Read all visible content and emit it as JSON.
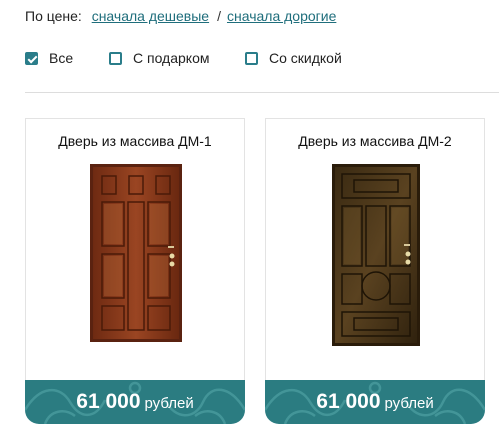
{
  "sort": {
    "label": "По цене:",
    "cheap_first": "сначала дешевые",
    "separator": "/",
    "expensive_first": "сначала дорогие"
  },
  "filters": [
    {
      "label": "Все",
      "checked": true
    },
    {
      "label": "С подарком",
      "checked": false
    },
    {
      "label": "Со скидкой",
      "checked": false
    }
  ],
  "products": [
    {
      "title": "Дверь из массива ДМ-1",
      "price": "61 000",
      "currency": "рублей",
      "door_color": "#8a3a1c"
    },
    {
      "title": "Дверь из массива ДМ-2",
      "price": "61 000",
      "currency": "рублей",
      "door_color": "#4a3418"
    }
  ],
  "colors": {
    "accent": "#2a7d8a",
    "link": "#1f6e7c",
    "price_band": "#2b7c81"
  }
}
